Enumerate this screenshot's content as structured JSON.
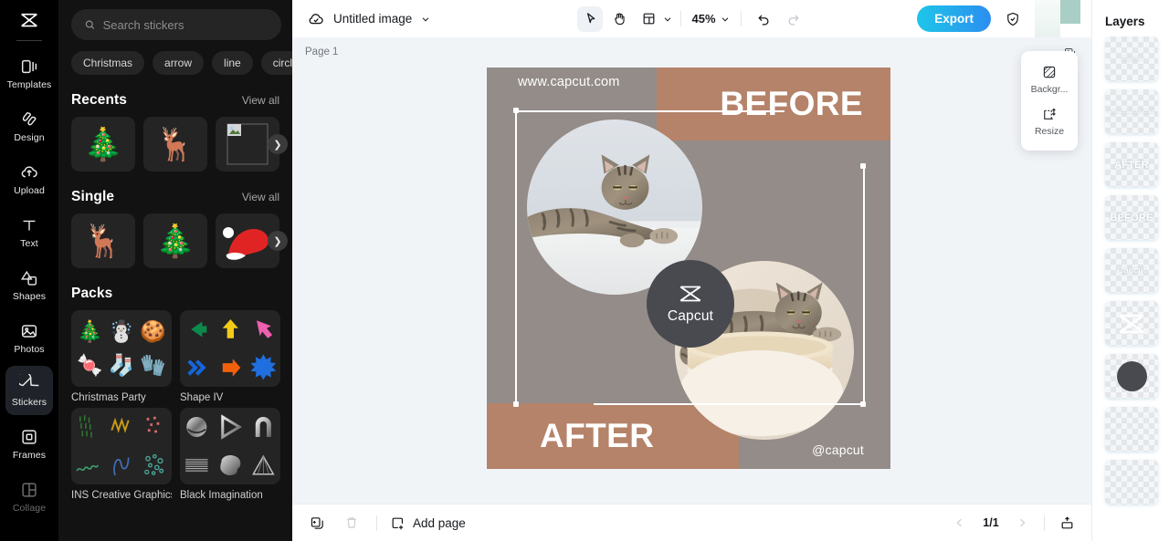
{
  "app": {
    "name": "CapCut",
    "logo_icon": "capcut-logo-icon"
  },
  "rail": {
    "items": [
      {
        "label": "Templates",
        "icon": "templates-icon",
        "active": false
      },
      {
        "label": "Design",
        "icon": "design-icon",
        "active": false
      },
      {
        "label": "Upload",
        "icon": "upload-icon",
        "active": false
      },
      {
        "label": "Text",
        "icon": "text-icon",
        "active": false
      },
      {
        "label": "Shapes",
        "icon": "shapes-icon",
        "active": false
      },
      {
        "label": "Photos",
        "icon": "photos-icon",
        "active": false
      },
      {
        "label": "Stickers",
        "icon": "stickers-icon",
        "active": true
      },
      {
        "label": "Frames",
        "icon": "frames-icon",
        "active": false
      },
      {
        "label": "Collage",
        "icon": "collage-icon",
        "active": false
      }
    ]
  },
  "sticker_panel": {
    "search": {
      "placeholder": "Search stickers",
      "value": "",
      "icon": "search-icon"
    },
    "chips": [
      "Christmas",
      "arrow",
      "line",
      "circle"
    ],
    "sections": [
      {
        "title": "Recents",
        "more_label": "View all",
        "items": [
          {
            "name": "christmas-tree-sticker",
            "glyph": "🎄"
          },
          {
            "name": "reindeer-face-sticker",
            "glyph": "🦌"
          },
          {
            "name": "image-placeholder-sticker",
            "glyph": ""
          }
        ]
      },
      {
        "title": "Single",
        "more_label": "View all",
        "items": [
          {
            "name": "reindeer-face-sticker",
            "glyph": "🦌"
          },
          {
            "name": "christmas-tree-sticker",
            "glyph": "🎄"
          },
          {
            "name": "santa-hat-sticker",
            "glyph": "🎅"
          }
        ]
      }
    ],
    "packs_title": "Packs",
    "packs": [
      {
        "name": "Christmas Party",
        "glyphs": [
          "🎄",
          "☃️",
          "🍪",
          "🍬",
          "🧦",
          "🧤"
        ]
      },
      {
        "name": "Shape IV",
        "glyphs": []
      },
      {
        "name": "INS Creative Graphics",
        "glyphs": []
      },
      {
        "name": "Black Imagination",
        "glyphs": []
      }
    ]
  },
  "topbar": {
    "cloud_icon": "cloud-saved-icon",
    "doc_title": "Untitled image",
    "doc_caret_icon": "chevron-down-icon",
    "tools": [
      {
        "name": "select-tool",
        "icon": "cursor-arrow-icon",
        "selected": true
      },
      {
        "name": "hand-tool",
        "icon": "hand-icon",
        "selected": false
      },
      {
        "name": "layout-tool",
        "icon": "layout-grid-icon",
        "selected": false
      }
    ],
    "layout_caret_icon": "chevron-down-icon",
    "zoom_value": "45%",
    "zoom_caret_icon": "chevron-down-icon",
    "undo": {
      "icon": "undo-icon",
      "enabled": true
    },
    "redo": {
      "icon": "redo-icon",
      "enabled": false
    },
    "export_label": "Export",
    "export_color_start": "#1ec6e8",
    "export_color_end": "#2b8ef0",
    "shield_icon": "shield-check-icon",
    "avatar_name": "user-avatar"
  },
  "stage": {
    "page_label": "Page 1",
    "duplicate_page_icon": "duplicate-page-icon",
    "background": "#f1f4f7"
  },
  "artboard": {
    "base_color": "#938c88",
    "band_color": "#b5836a",
    "before_text": "BEFORE",
    "after_text": "AFTER",
    "watermark_top": "www.capcut.com",
    "watermark_bottom": "@capcut",
    "badge": {
      "label": "Capcut",
      "icon": "capcut-logo-icon",
      "color": "#484a50"
    },
    "photos": [
      {
        "name": "cat-photo-before",
        "alt": "tabby cat lying on white shelf"
      },
      {
        "name": "cat-photo-after",
        "alt": "tabby cat lying on cream cat bed"
      }
    ]
  },
  "popover": {
    "items": [
      {
        "label": "Backgr...",
        "icon": "background-icon"
      },
      {
        "label": "Resize",
        "icon": "resize-icon"
      }
    ]
  },
  "annotation": {
    "name": "red-arrow-pointer",
    "color": "#f04438",
    "points_to": "Export"
  },
  "bottombar": {
    "duplicate_icon": "duplicate-page-icon",
    "delete_icon": "trash-icon",
    "add_page_label": "Add page",
    "add_page_icon": "add-page-icon",
    "prev_icon": "chevron-left-icon",
    "next_icon": "chevron-right-icon",
    "page_indicator": "1/1",
    "expand_icon": "expand-panel-icon"
  },
  "layers": {
    "title": "Layers",
    "items": [
      {
        "name": "layer-capcut-badge-text",
        "label": "Capcut",
        "style": "sm"
      },
      {
        "name": "layer-watermark-url",
        "label": "www.capcut.com",
        "style": "sm"
      },
      {
        "name": "layer-after-text",
        "label": "AFTER",
        "style": "bold"
      },
      {
        "name": "layer-before-text",
        "label": "BEFORE",
        "style": "bold"
      },
      {
        "name": "layer-capcut-text",
        "label": "Capcut",
        "style": "md"
      },
      {
        "name": "layer-capcut-logo",
        "label": "",
        "style": "logo"
      },
      {
        "name": "layer-dark-circle",
        "label": "",
        "style": "circle"
      },
      {
        "name": "layer-empty-1",
        "label": "",
        "style": "empty"
      },
      {
        "name": "layer-empty-2",
        "label": "",
        "style": "empty"
      }
    ]
  }
}
